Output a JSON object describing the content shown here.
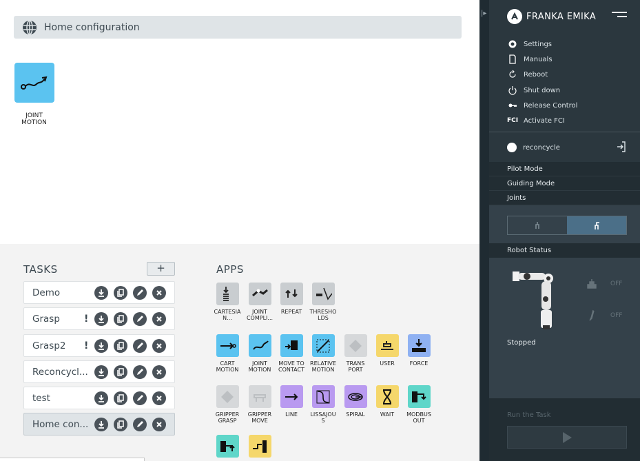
{
  "task_header": {
    "title": "Home configuration",
    "icon": "globe-icon"
  },
  "timeline": [
    {
      "label": "JOINT\nMOTION",
      "color": "#5bc3f0",
      "icon": "joint-motion-icon"
    }
  ],
  "tasks": {
    "title": "TASKS",
    "add_label": "+",
    "items": [
      {
        "name": "Demo",
        "warning": ""
      },
      {
        "name": "Grasp",
        "warning": "!"
      },
      {
        "name": "Grasp2",
        "warning": "!"
      },
      {
        "name": "Reconcycl...",
        "warning": ""
      },
      {
        "name": "test",
        "warning": ""
      },
      {
        "name": "Home con...",
        "warning": "",
        "active": true
      }
    ],
    "row_actions": [
      "download-icon",
      "duplicate-icon",
      "edit-icon",
      "delete-icon"
    ]
  },
  "apps": {
    "title": "APPS",
    "items": [
      {
        "label": "CARTESIA\nN...",
        "color": "#c9cdd0",
        "icon": "cartesian-impedance-icon"
      },
      {
        "label": "JOINT\nCOMPLI...",
        "color": "#c9cdd0",
        "icon": "joint-compliance-icon"
      },
      {
        "label": "REPEAT",
        "color": "#c9cdd0",
        "icon": "repeat-icon"
      },
      {
        "label": "THRESHO\nLDS",
        "color": "#c9cdd0",
        "icon": "thresholds-icon"
      },
      {
        "label": "CART\nMOTION",
        "color": "#5bc3f0",
        "icon": "cart-motion-icon"
      },
      {
        "label": "JOINT\nMOTION",
        "color": "#5bc3f0",
        "icon": "joint-motion-icon"
      },
      {
        "label": "MOVE TO\nCONTACT",
        "color": "#5bc3f0",
        "icon": "move-to-contact-icon"
      },
      {
        "label": "RELATIVE\nMOTION",
        "color": "#5bc3f0",
        "icon": "relative-motion-icon"
      },
      {
        "label": "TRANS\nPORT",
        "color": "#d6d8da",
        "icon": "transport-icon"
      },
      {
        "label": "USER",
        "color": "#f5d76b",
        "icon": "user-app-icon"
      },
      {
        "label": "FORCE",
        "color": "#8fb1f2",
        "icon": "force-icon"
      },
      {
        "label": "GRIPPER\nGRASP",
        "color": "#d6d8da",
        "icon": "gripper-grasp-icon"
      },
      {
        "label": "GRIPPER\nMOVE",
        "color": "#d6d8da",
        "icon": "gripper-move-icon"
      },
      {
        "label": "LINE",
        "color": "#b99af0",
        "icon": "line-icon"
      },
      {
        "label": "LISSAJOU\nS",
        "color": "#b99af0",
        "icon": "lissajous-icon"
      },
      {
        "label": "SPIRAL",
        "color": "#b99af0",
        "icon": "spiral-icon"
      },
      {
        "label": "WAIT",
        "color": "#f5d76b",
        "icon": "hourglass-icon"
      },
      {
        "label": "MODBUS\nOUT",
        "color": "#5fd6c9",
        "icon": "modbus-out-icon"
      },
      {
        "label": "",
        "color": "#5fd6c9",
        "icon": "modbus-in-icon"
      },
      {
        "label": "",
        "color": "#f5d76b",
        "icon": "signal-icon"
      }
    ]
  },
  "sidebar": {
    "brand": "FRANKA EMIKA",
    "menu": [
      {
        "label": "Settings",
        "icon": "gear-icon"
      },
      {
        "label": "Manuals",
        "icon": "manual-icon"
      },
      {
        "label": "Reboot",
        "icon": "reboot-icon"
      },
      {
        "label": "Shut down",
        "icon": "power-icon"
      },
      {
        "label": "Release Control",
        "icon": "key-icon"
      },
      {
        "label": "Activate FCI",
        "icon": "fci-icon",
        "icon_text": "FCI"
      }
    ],
    "user": "reconcycle",
    "modes": [
      "Pilot Mode",
      "Guiding Mode",
      "Joints"
    ],
    "robot_status_title": "Robot Status",
    "status_items": [
      {
        "label": "OFF",
        "icon": "gripper-status-icon"
      },
      {
        "label": "OFF",
        "icon": "end-effector-status-icon"
      }
    ],
    "state": "Stopped",
    "run_label": "Run the Task"
  }
}
